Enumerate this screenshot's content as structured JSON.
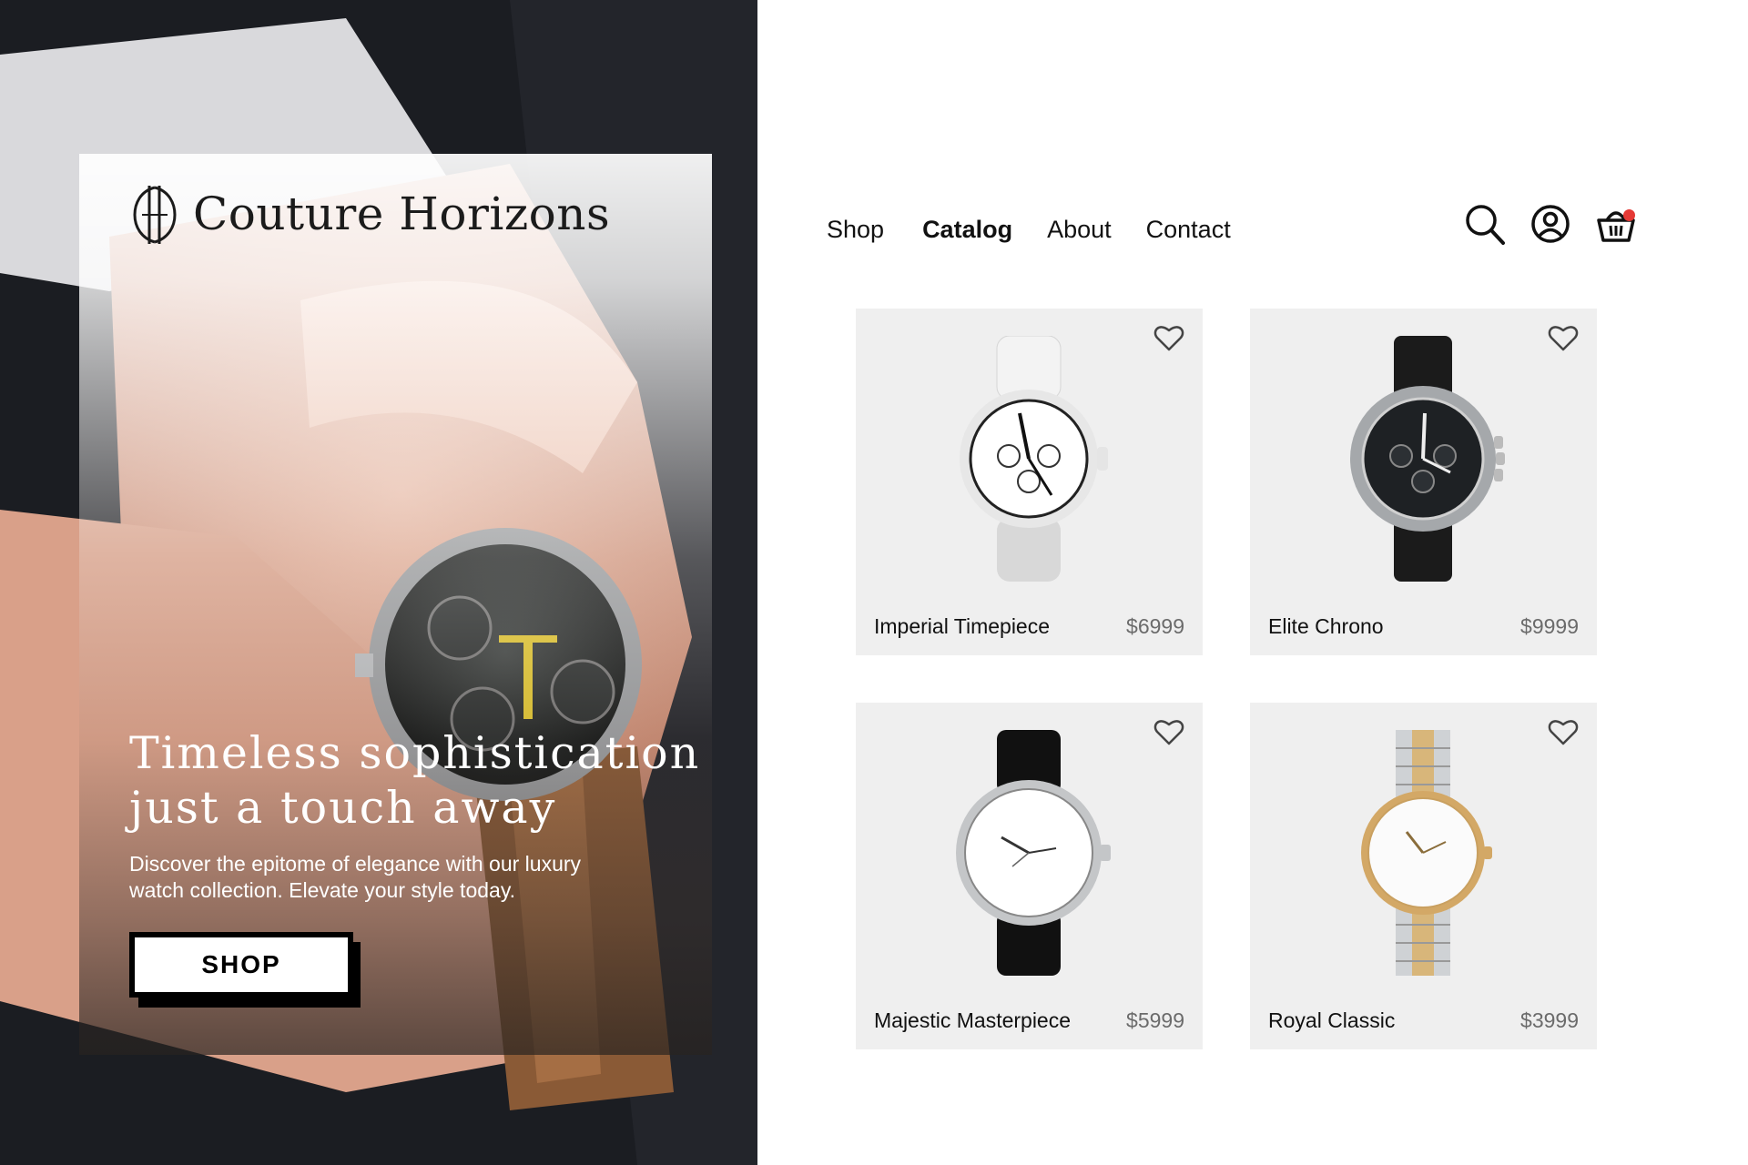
{
  "brand": {
    "name": "Couture Horizons"
  },
  "nav": {
    "items": [
      {
        "label": "Shop",
        "active": false
      },
      {
        "label": "Catalog",
        "active": true
      },
      {
        "label": "About",
        "active": false
      },
      {
        "label": "Contact",
        "active": false
      }
    ],
    "icons": [
      "search-icon",
      "user-account-icon",
      "shopping-basket-icon"
    ],
    "cart_badge_color": "#e53935"
  },
  "hero": {
    "title_line1": "Timeless sophistication",
    "title_line2": "just a touch away",
    "subtitle": "Discover the epitome of elegance with our luxury watch collection. Elevate your style today.",
    "cta_label": "SHOP"
  },
  "products": [
    {
      "name": "Imperial Timepiece",
      "price": "$6999",
      "style": "white"
    },
    {
      "name": "Elite Chrono",
      "price": "$9999",
      "style": "black-steel"
    },
    {
      "name": "Majestic Masterpiece",
      "price": "$5999",
      "style": "white-dial-black-strap"
    },
    {
      "name": "Royal Classic",
      "price": "$3999",
      "style": "two-tone-bracelet"
    }
  ],
  "colors": {
    "card_bg": "#efefef",
    "price_text": "#6b6b6b",
    "accent": "#000000"
  }
}
